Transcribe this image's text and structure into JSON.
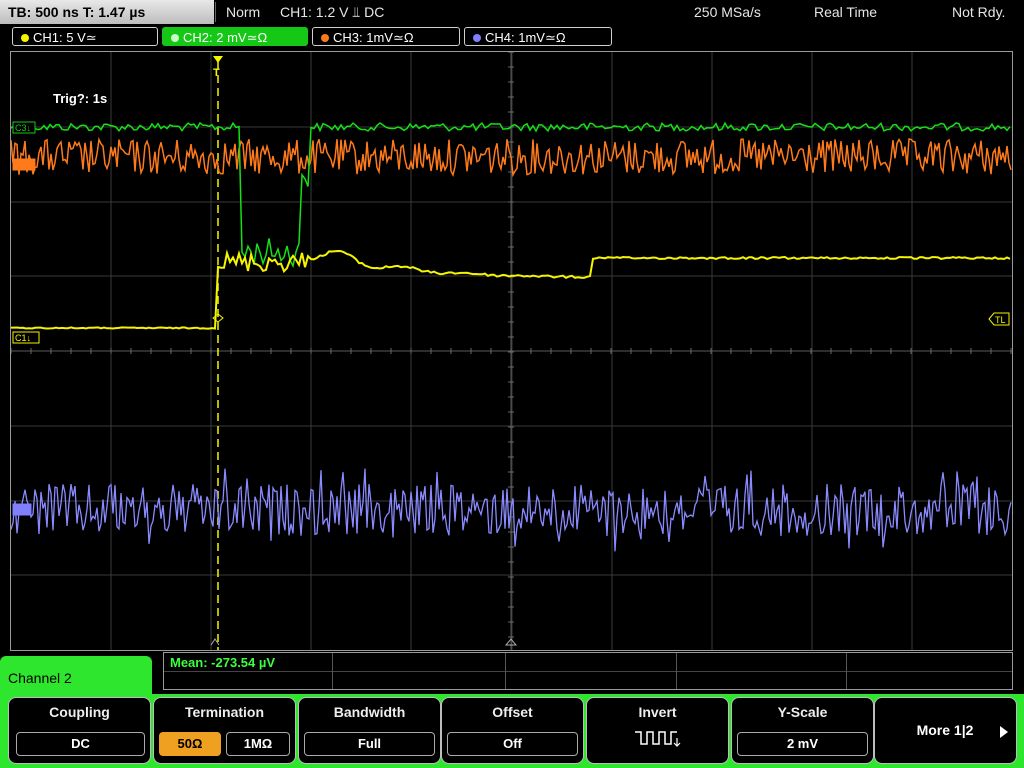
{
  "topbar": {
    "timebase": "TB: 500 ns   T: 1.47 µs",
    "mode": "Norm",
    "trigger": "CH1: 1.2 V  ⫫ DC",
    "samplerate": "250 MSa/s",
    "acq": "Real Time",
    "status": "Not Rdy."
  },
  "channels": [
    {
      "label": "CH1: 5 V≃",
      "color": "#f5f500"
    },
    {
      "label": "CH2: 2 mV≃Ω",
      "color": "#16c816"
    },
    {
      "label": "CH3: 1mV≃Ω",
      "color": "#ff7a1a"
    },
    {
      "label": "CH4: 1mV≃Ω",
      "color": "#8080ff"
    }
  ],
  "screen": {
    "trigger_info": "Trig?: 1s",
    "marker_c3": "C3↓",
    "marker_c1": "C1↓",
    "marker_c4": "C4",
    "marker_tl": "TL",
    "marker_t": "T"
  },
  "measurement": {
    "mean": "Mean: -273.54 µV"
  },
  "menu": {
    "title": "Channel 2",
    "coupling": {
      "title": "Coupling",
      "value": "DC"
    },
    "termination": {
      "title": "Termination",
      "opt1": "50Ω",
      "opt2": "1MΩ"
    },
    "bandwidth": {
      "title": "Bandwidth",
      "value": "Full"
    },
    "offset": {
      "title": "Offset",
      "value": "Off"
    },
    "invert": {
      "title": "Invert"
    },
    "yscale": {
      "title": "Y-Scale",
      "value": "2 mV"
    },
    "more": {
      "label": "More 1|2"
    }
  },
  "colors": {
    "ch1": "#f5f500",
    "ch2": "#16c816",
    "ch3": "#ff7a1a",
    "ch4": "#8080ff",
    "menu_green": "#2ee62e",
    "selected_orange": "#f0a020"
  }
}
